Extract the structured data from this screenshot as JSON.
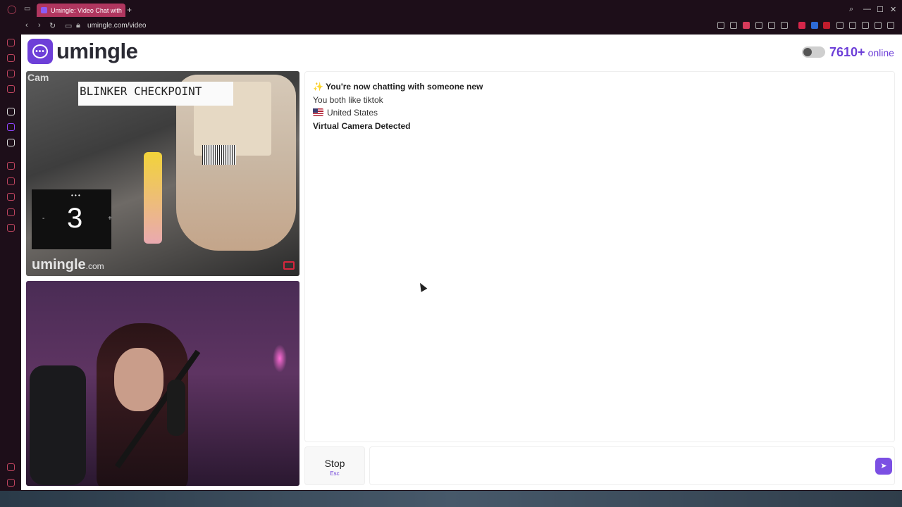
{
  "browser": {
    "tab_title": "Umingle: Video Chat with",
    "new_tab_icon": "plus-icon",
    "url": "umingle.com/video"
  },
  "header": {
    "logo_text": "umingle",
    "online_count": "7610+",
    "online_label": "online",
    "toggle_on": false
  },
  "stranger_video": {
    "cam_label": "Cam",
    "overlay_text": "BLINKER CHECKPOINT",
    "counter_value": "3",
    "counter_minus": "-",
    "counter_plus": "+",
    "counter_dots": "• • •",
    "watermark": "umingle",
    "watermark_suffix": ".com"
  },
  "chat": {
    "messages": [
      {
        "icon": "sparkles-icon",
        "prefix": "✨",
        "text": "You're now chatting with someone new"
      },
      {
        "text": "You both like tiktok"
      },
      {
        "icon": "us-flag-icon",
        "text": "United States"
      },
      {
        "text": "Virtual Camera Detected"
      }
    ]
  },
  "controls": {
    "stop_label": "Stop",
    "stop_shortcut": "Esc",
    "message_placeholder": "",
    "send_icon": "send-icon"
  },
  "colors": {
    "brand": "#6d3fd8",
    "tab_active": "#b0365f"
  }
}
